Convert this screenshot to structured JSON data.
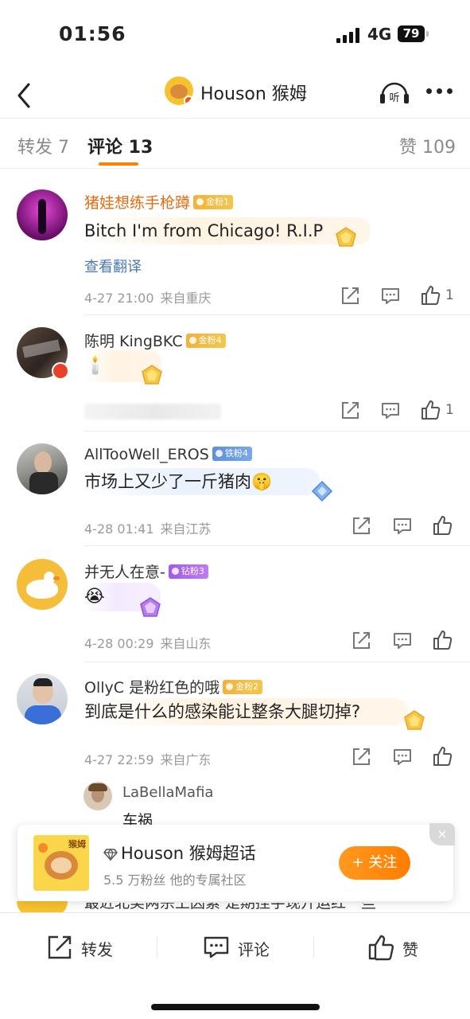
{
  "status_bar": {
    "time": "01:56",
    "network": "4G",
    "battery": "79"
  },
  "nav": {
    "title": "Houson 猴姆",
    "listen_label": "听"
  },
  "tabs": [
    {
      "label": "转发 7"
    },
    {
      "label": "评论 13"
    },
    {
      "label": "赞 109"
    }
  ],
  "comments": [
    {
      "name": "猪娃想练手枪蹲",
      "badge": "金粉1",
      "badge_type": "gold",
      "text": "Bitch I'm from Chicago! R.I.P",
      "translate": "查看翻译",
      "time": "4-27 21:00",
      "location": "来自重庆",
      "likes": "1"
    },
    {
      "name": "陈明 KingBKC",
      "badge": "金粉4",
      "badge_type": "gold",
      "text": "🕯️",
      "time": "",
      "location": "",
      "likes": "1"
    },
    {
      "name": "AllTooWell_EROS",
      "badge": "铁粉4",
      "badge_type": "iron",
      "text": "市场上又少了一斤猪肉🤫",
      "time": "4-28 01:41",
      "location": "来自江苏",
      "likes": ""
    },
    {
      "name": "并无人在意-",
      "badge": "钻粉3",
      "badge_type": "diamond",
      "text": "😭",
      "time": "4-28 00:29",
      "location": "来自山东",
      "likes": ""
    },
    {
      "name": "OllyC 是粉红色的哦",
      "badge": "金粉2",
      "badge_type": "gold",
      "text": "到底是什么的感染能让整条大腿切掉?",
      "time": "4-27 22:59",
      "location": "来自广东",
      "likes": ""
    }
  ],
  "reply": {
    "name": "LaBellaMafia",
    "text": "车祸"
  },
  "super_topic": {
    "thumb_tag": "猴姆",
    "title": "Houson 猴姆超话",
    "subtitle": "5.5 万粉丝 他的专属社区",
    "follow_label": "+ 关注",
    "close_label": "×"
  },
  "peek": {
    "text": "最近北美两宗上因素 是期挫字现开运红一些"
  },
  "bottom_bar": {
    "repost": "转发",
    "comment": "评论",
    "like": "赞"
  },
  "colors": {
    "accent": "#ff8200",
    "link": "#4a78b8"
  }
}
